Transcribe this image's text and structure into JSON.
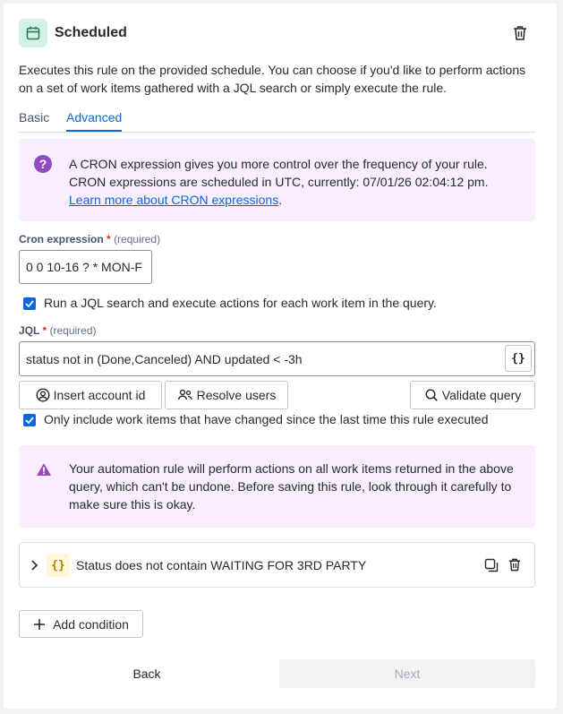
{
  "header": {
    "title": "Scheduled",
    "description": "Executes this rule on the provided schedule. You can choose if you'd like to perform actions on a set of work items gathered with a JQL search or simply execute the rule."
  },
  "tabs": [
    {
      "label": "Basic",
      "active": false
    },
    {
      "label": "Advanced",
      "active": true
    }
  ],
  "info": {
    "text": "A CRON expression gives you more control over the frequency of your rule. CRON expressions are scheduled in UTC, currently: 07/01/26 02:04:12 pm.",
    "link": "Learn more about CRON expressions",
    "link_suffix": "."
  },
  "cron": {
    "label": "Cron expression",
    "required_star": "*",
    "required_text": "(required)",
    "value": "0 0 10-16 ? * MON-F"
  },
  "jql_checkbox": {
    "checked": true,
    "label": "Run a JQL search and execute actions for each work item in the query."
  },
  "jql": {
    "label": "JQL",
    "required_star": "*",
    "required_text": "(required)",
    "value": "status not in (Done,Canceled) AND updated < -3h",
    "braces_button": "{}"
  },
  "actions": {
    "insert_account": "Insert account id",
    "resolve_users": "Resolve users",
    "validate_query": "Validate query"
  },
  "changed_checkbox": {
    "checked": true,
    "label": "Only include work items that have changed since the last time this rule executed"
  },
  "warning": {
    "text": "Your automation rule will perform actions on all work items returned in the above query, which can't be undone. Before saving this rule, look through it carefully to make sure this is okay."
  },
  "condition": {
    "badge": "{}",
    "text": "Status does not contain WAITING FOR 3RD PARTY"
  },
  "add_condition": "Add condition",
  "footer": {
    "back": "Back",
    "next": "Next"
  },
  "colors": {
    "accent": "#0c66e4",
    "info_bg": "#f8eefe",
    "help_purple": "#964ac0",
    "header_icon_bg": "#d3f1e4",
    "badge_bg": "#fff7d6",
    "next_disabled_bg": "#f1f2f4"
  }
}
